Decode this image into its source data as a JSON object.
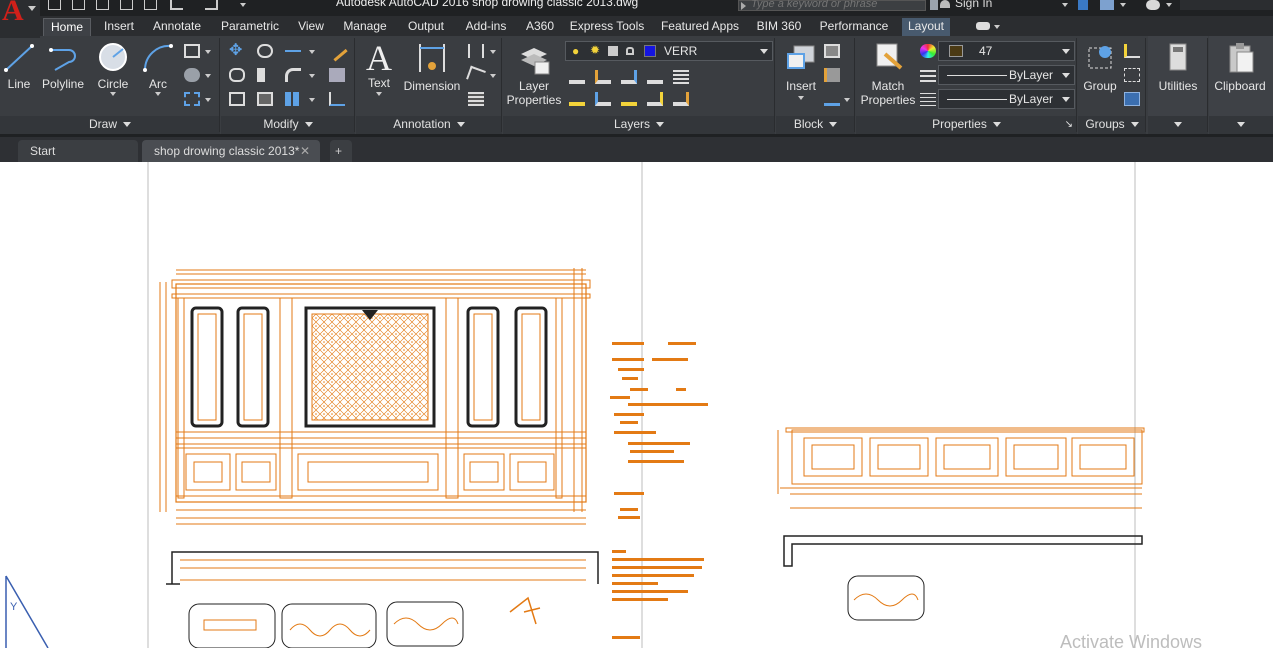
{
  "titlebar": {
    "title": "Autodesk AutoCAD 2016    shop drowing classic 2013.dwg",
    "search_placeholder": "Type a keyword or phrase",
    "signin": "Sign In"
  },
  "ribbon_tabs": [
    "Home",
    "Insert",
    "Annotate",
    "Parametric",
    "View",
    "Manage",
    "Output",
    "Add-ins",
    "A360",
    "Express Tools",
    "Featured Apps",
    "BIM 360",
    "Performance",
    "Layout"
  ],
  "draw": {
    "label": "Draw",
    "line": "Line",
    "polyline": "Polyline",
    "circle": "Circle",
    "arc": "Arc"
  },
  "modify": {
    "label": "Modify"
  },
  "annotation": {
    "label": "Annotation",
    "text": "Text",
    "dimension": "Dimension"
  },
  "layers": {
    "label": "Layers",
    "layer_properties_1": "Layer",
    "layer_properties_2": "Properties",
    "current_layer": "VERR"
  },
  "block": {
    "label": "Block",
    "insert": "Insert"
  },
  "properties": {
    "label": "Properties",
    "match_1": "Match",
    "match_2": "Properties",
    "color": "47",
    "linetype": "ByLayer",
    "lineweight": "ByLayer"
  },
  "groups": {
    "label": "Groups",
    "group": "Group"
  },
  "utilities": {
    "label": "Utilities"
  },
  "clipboard": {
    "label": "Clipboard"
  },
  "file_tabs": {
    "start": "Start",
    "doc": "shop drowing classic 2013*",
    "new": "+"
  },
  "watermark": "Activate Windows",
  "colors": {
    "accent_orange": "#e37a14",
    "layer_swatch": "#1515e0",
    "color_swatch": "#4b3a14",
    "autocad_red": "#d0201a"
  }
}
